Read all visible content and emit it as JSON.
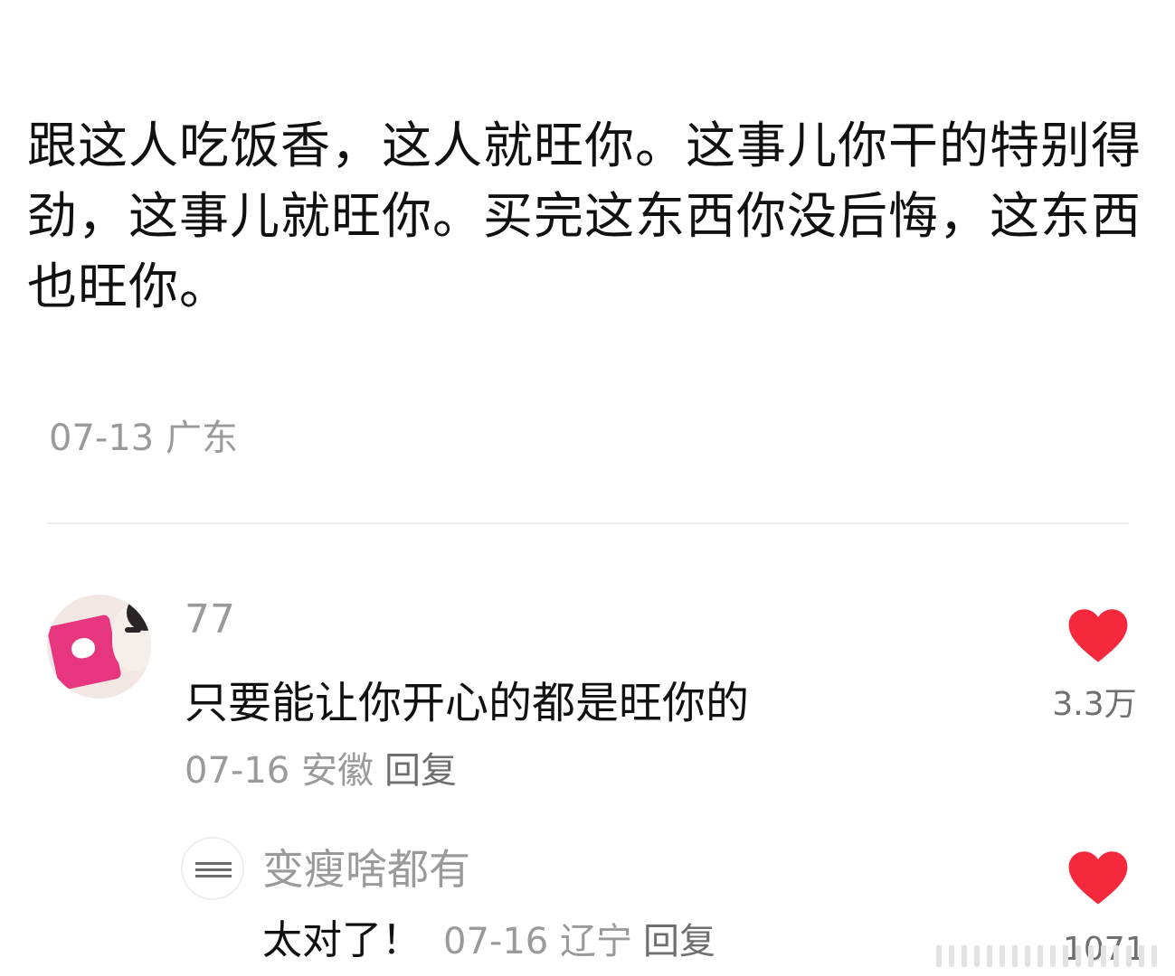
{
  "post": {
    "text": "跟这人吃饭香，这人就旺你。这事儿你干的特别得劲，这事儿就旺你。买完这东西你没后悔，这东西也旺你。",
    "meta": "07-13 广东"
  },
  "comments": [
    {
      "username": "77",
      "text": "只要能让你开心的都是旺你的",
      "meta": "07-16 安徽",
      "reply_label": "回复",
      "like_count": "3.3万",
      "like_icon": "heart-icon",
      "like_color": "#f5283c"
    },
    {
      "username": "变瘦啥都有",
      "text": "太对了！",
      "meta": "07-16 辽宁",
      "reply_label": "回复",
      "like_count": "1071",
      "like_icon": "heart-icon",
      "like_color": "#f5283c"
    }
  ]
}
